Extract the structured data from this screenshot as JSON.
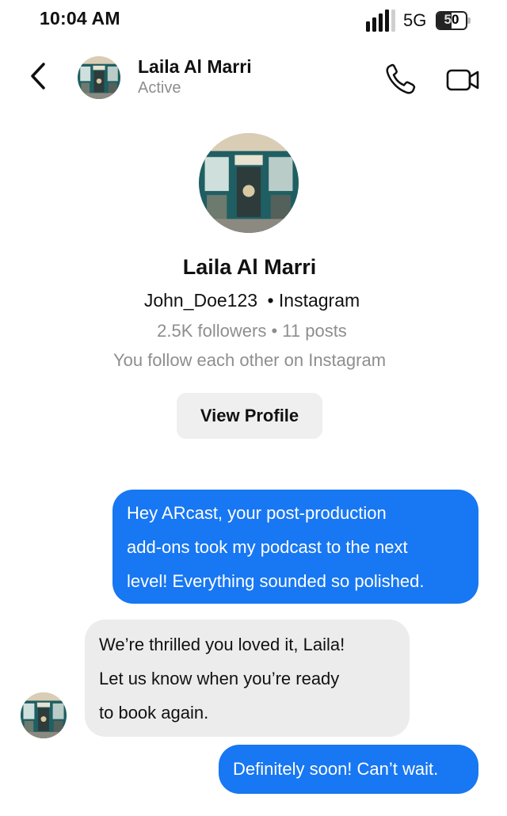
{
  "status_bar": {
    "time": "10:04 AM",
    "network": "5G",
    "battery_level": "50",
    "battery_fraction": 0.5
  },
  "header": {
    "back_icon": "chevron-left-icon",
    "name": "Laila Al Marri",
    "status": "Active",
    "call_icon": "phone-icon",
    "video_icon": "video-camera-icon"
  },
  "profile": {
    "name": "Laila Al Marri",
    "handle": "John_Doe123",
    "platform": "• Instagram",
    "stats": "2.5K followers • 11 posts",
    "mutual": "You follow each other on Instagram",
    "view_profile_label": "View Profile"
  },
  "messages": [
    {
      "direction": "outgoing",
      "lines": [
        "Hey ARcast, your post-production",
        "add-ons took my podcast to the next",
        "level! Everything sounded so polished."
      ]
    },
    {
      "direction": "incoming",
      "lines": [
        "We’re thrilled you loved it, Laila!",
        "Let us know when you’re ready",
        "to book again."
      ]
    },
    {
      "direction": "outgoing",
      "lines": [
        "Definitely soon! Can’t wait."
      ]
    }
  ],
  "colors": {
    "outgoing_bubble": "#1877f2",
    "incoming_bubble": "#ececec",
    "secondary_text": "#8e8e8e"
  }
}
